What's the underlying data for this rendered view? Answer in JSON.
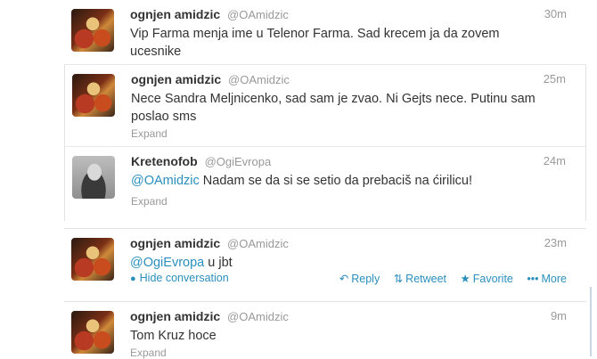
{
  "tweets": [
    {
      "fullname": "ognjen amidzic",
      "username": "@OAmidzic",
      "time": "30m",
      "text": "Vip Farma menja ime u Telenor Farma. Sad krecem ja da zovem ucesnike"
    },
    {
      "fullname": "ognjen amidzic",
      "username": "@OAmidzic",
      "time": "25m",
      "text": "Nece Sandra Meljnicenko, sad sam je zvao. Ni Gejts nece. Putinu sam poslao sms",
      "expand": "Expand"
    },
    {
      "fullname": "Kretenofob",
      "username": "@OgiEvropa",
      "time": "24m",
      "mention": "@OAmidzic",
      "text": " Nadam se da si se setio da prebaciš na ćirilicu!",
      "expand": "Expand"
    },
    {
      "fullname": "ognjen amidzic",
      "username": "@OAmidzic",
      "time": "23m",
      "mention": "@OgiEvropa",
      "text": " u jbt",
      "hide_conversation": "Hide conversation",
      "actions": {
        "reply": "Reply",
        "retweet": "Retweet",
        "favorite": "Favorite",
        "more": "More"
      }
    },
    {
      "fullname": "ognjen amidzic",
      "username": "@OAmidzic",
      "time": "9m",
      "text": "Tom Kruz hoce",
      "expand": "Expand"
    }
  ],
  "icons": {
    "speech": "speech-bubble-icon",
    "reply": "reply-icon",
    "retweet": "retweet-icon",
    "favorite": "star-icon",
    "more": "more-icon"
  },
  "colors": {
    "link": "#2a8fbd",
    "meta": "#999999",
    "text": "#333333"
  }
}
